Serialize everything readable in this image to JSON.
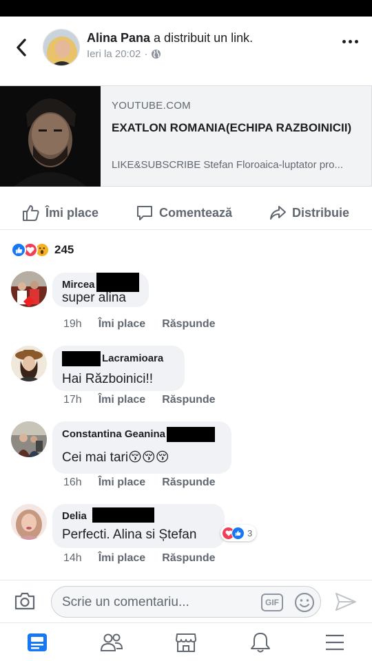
{
  "post": {
    "author": "Alina Pana",
    "action_text": "a distribuit un link.",
    "timestamp": "Ieri la 20:02",
    "separator": "·",
    "privacy_icon": "globe-icon"
  },
  "link": {
    "domain": "YOUTUBE.COM",
    "title": "EXATLON ROMANIA(ECHIPA RAZBOINICII)",
    "description": "LIKE&SUBSCRIBE Stefan Floroaica-luptator pro..."
  },
  "actions": {
    "like": "Îmi place",
    "comment": "Comentează",
    "share": "Distribuie"
  },
  "reactions": {
    "types": [
      "like",
      "love",
      "wow"
    ],
    "count": "245"
  },
  "comments": [
    {
      "name_visible": "Mircea",
      "text": "super alina",
      "time": "19h",
      "like_label": "Îmi place",
      "reply_label": "Răspunde"
    },
    {
      "name_visible": "Lacramioara",
      "text": "Hai Războinici!!",
      "time": "17h",
      "like_label": "Îmi place",
      "reply_label": "Răspunde"
    },
    {
      "name_visible": "Constantina Geanina",
      "text": "Cei mai tari😚😚😚",
      "time": "16h",
      "like_label": "Îmi place",
      "reply_label": "Răspunde"
    },
    {
      "name_visible": "Delia",
      "text": "Perfecti. Alina si Ștefan",
      "time": "14h",
      "like_label": "Îmi place",
      "reply_label": "Răspunde",
      "reaction_count": "3"
    }
  ],
  "composer": {
    "placeholder": "Scrie un comentariu...",
    "gif_label": "GIF"
  },
  "tabs": [
    "news-feed-icon",
    "friends-icon",
    "marketplace-icon",
    "notifications-icon",
    "menu-icon"
  ],
  "colors": {
    "accent": "#1877f2",
    "like": "#1877f2",
    "love": "#f33e58",
    "wow": "#f7b125",
    "bubble": "#f0f2f5",
    "secondary_text": "#606770"
  }
}
